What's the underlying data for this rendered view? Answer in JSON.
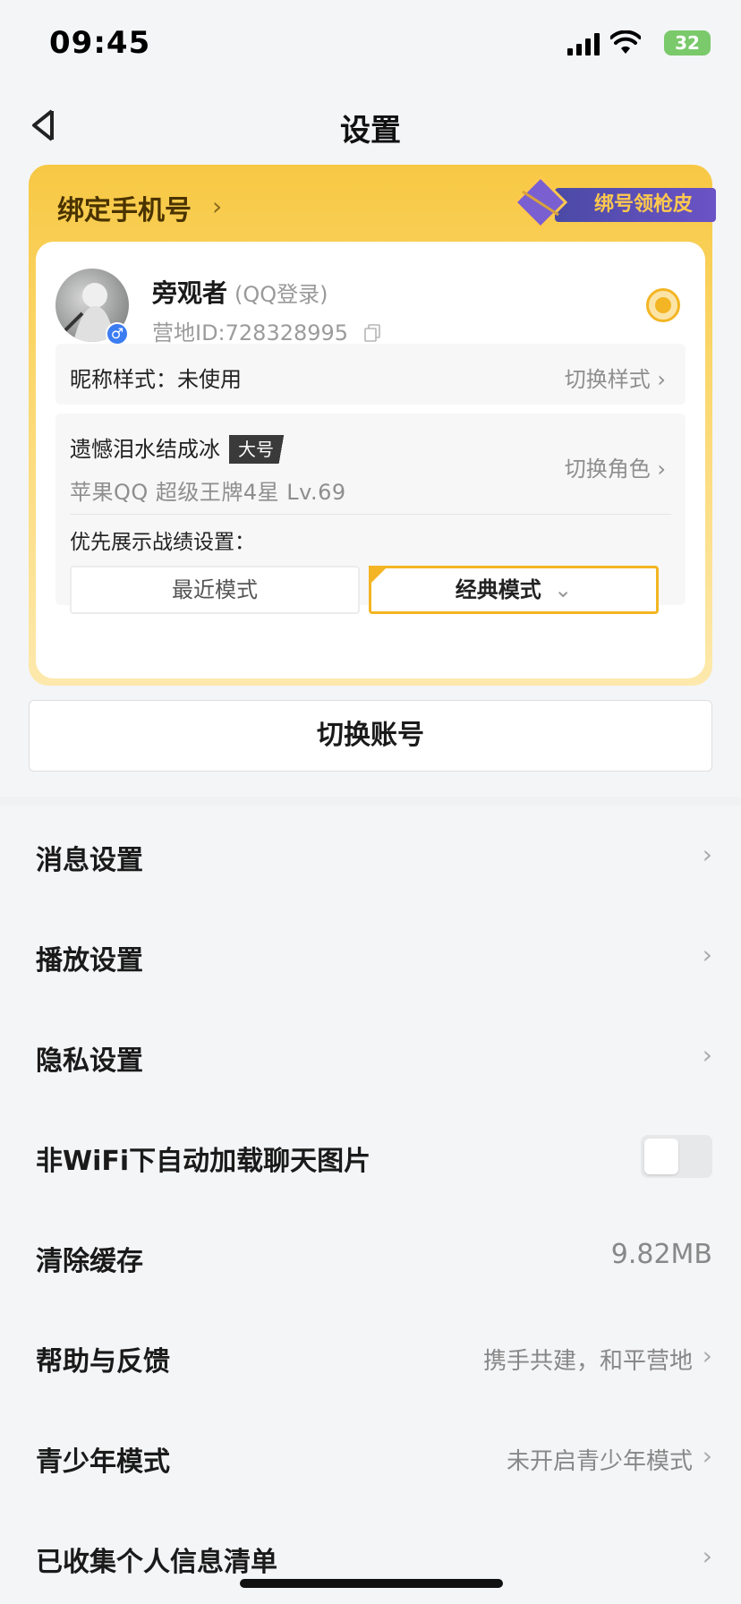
{
  "status_bar": {
    "time": "09:45",
    "battery": "32"
  },
  "nav": {
    "title": "设置"
  },
  "account_card": {
    "bind_phone_label": "绑定手机号",
    "skin_promo_label": "绑号领枪皮",
    "nickname": "旁观者",
    "login_type": "(QQ登录)",
    "camp_id": "营地ID:728328995",
    "nickname_style_label": "昵称样式：未使用",
    "switch_style_label": "切换样式",
    "role_name": "遗憾泪水结成冰",
    "role_tag": "大号",
    "role_meta": "苹果QQ  超级王牌4星  Lv.69",
    "switch_role_label": "切换角色",
    "display_setting_label": "优先展示战绩设置：",
    "mode_recent": "最近模式",
    "mode_classic": "经典模式"
  },
  "switch_account_label": "切换账号",
  "settings": [
    {
      "label": "消息设置",
      "value": ""
    },
    {
      "label": "播放设置",
      "value": ""
    },
    {
      "label": "隐私设置",
      "value": ""
    },
    {
      "label": "非WiFi下自动加载聊天图片",
      "value": ""
    },
    {
      "label": "清除缓存",
      "value": "9.82MB"
    },
    {
      "label": "帮助与反馈",
      "value": "携手共建，和平营地"
    },
    {
      "label": "青少年模式",
      "value": "未开启青少年模式"
    },
    {
      "label": "已收集个人信息清单",
      "value": ""
    }
  ],
  "colors": {
    "accent": "#f3b523",
    "card_gradient_top": "#f7c844",
    "toggle_off": "#e7e8ea"
  },
  "toggle_wifi_images": false
}
